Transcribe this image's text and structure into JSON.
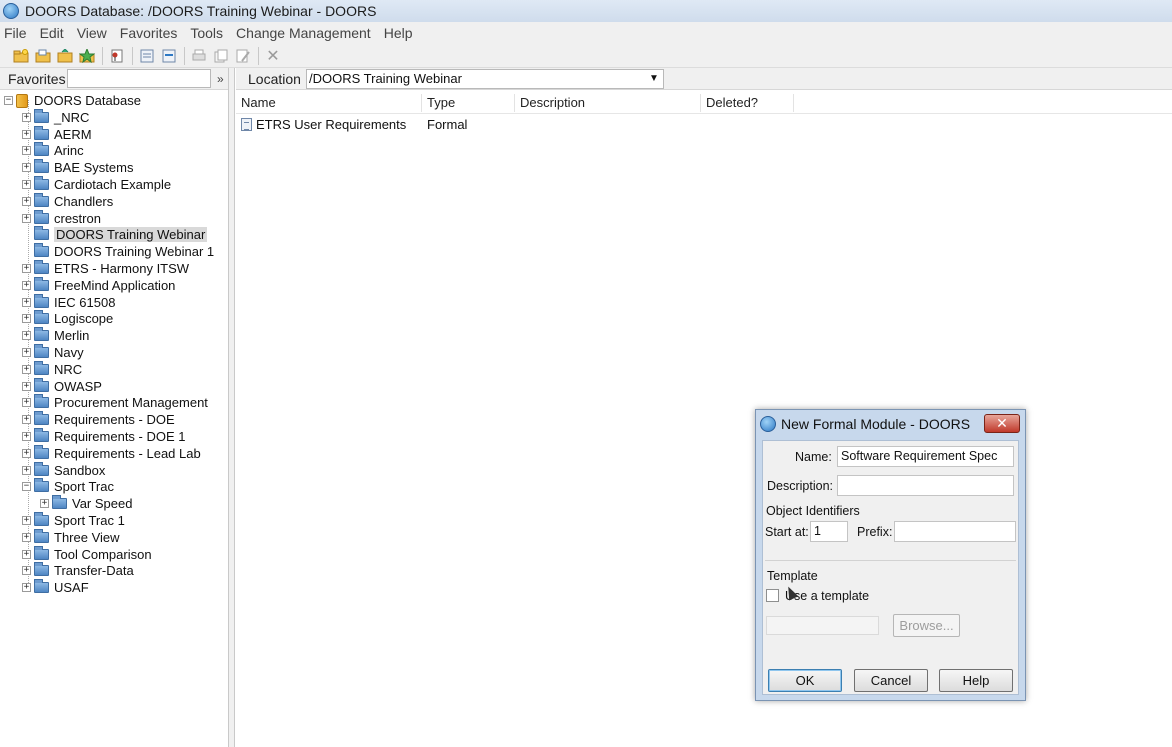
{
  "window": {
    "title": "DOORS Database: /DOORS Training Webinar - DOORS"
  },
  "menu": [
    "File",
    "Edit",
    "View",
    "Favorites",
    "Tools",
    "Change Management",
    "Help"
  ],
  "toolbar": {
    "icons": [
      "new-folder-icon",
      "new-project-icon",
      "open-folder-icon",
      "favorite-icon",
      "properties-icon",
      "new-module-icon",
      "link-module-icon",
      "print-icon",
      "copy-icon",
      "edit-icon",
      "delete-icon"
    ]
  },
  "favorites": {
    "label": "Favorites",
    "more": "»"
  },
  "tree": {
    "root": "DOORS Database",
    "items": [
      "_NRC",
      "AERM",
      "Arinc",
      "BAE Systems",
      "Cardiotach Example",
      "Chandlers",
      "crestron",
      "DOORS Training Webinar",
      "DOORS Training Webinar 1",
      "ETRS - Harmony ITSW",
      "FreeMind Application",
      "IEC 61508",
      "Logiscope",
      "Merlin",
      "Navy",
      "NRC",
      "OWASP",
      "Procurement Management",
      "Requirements - DOE",
      "Requirements - DOE 1",
      "Requirements - Lead Lab",
      "Sandbox",
      "Sport Trac",
      "Var Speed",
      "Sport Trac 1",
      "Three View",
      "Tool Comparison",
      "Transfer-Data",
      "USAF"
    ],
    "selected": "DOORS Training Webinar"
  },
  "location": {
    "label": "Location",
    "value": "/DOORS Training Webinar"
  },
  "list": {
    "columns": [
      "Name",
      "Type",
      "Description",
      "Deleted?"
    ],
    "rows": [
      {
        "name": "ETRS User Requirements",
        "type": "Formal",
        "description": "",
        "deleted": ""
      }
    ]
  },
  "dialog": {
    "title": "New Formal Module - DOORS",
    "close": "✕",
    "name_label": "Name:",
    "name_value": "Software Requirement Spec",
    "description_label": "Description:",
    "description_value": "",
    "object_identifiers_label": "Object Identifiers",
    "start_at_label": "Start at:",
    "start_at_value": "1",
    "prefix_label": "Prefix:",
    "prefix_value": "",
    "template_label": "Template",
    "use_template_label": "Use a template",
    "browse_label": "Browse...",
    "ok_label": "OK",
    "cancel_label": "Cancel",
    "help_label": "Help"
  }
}
